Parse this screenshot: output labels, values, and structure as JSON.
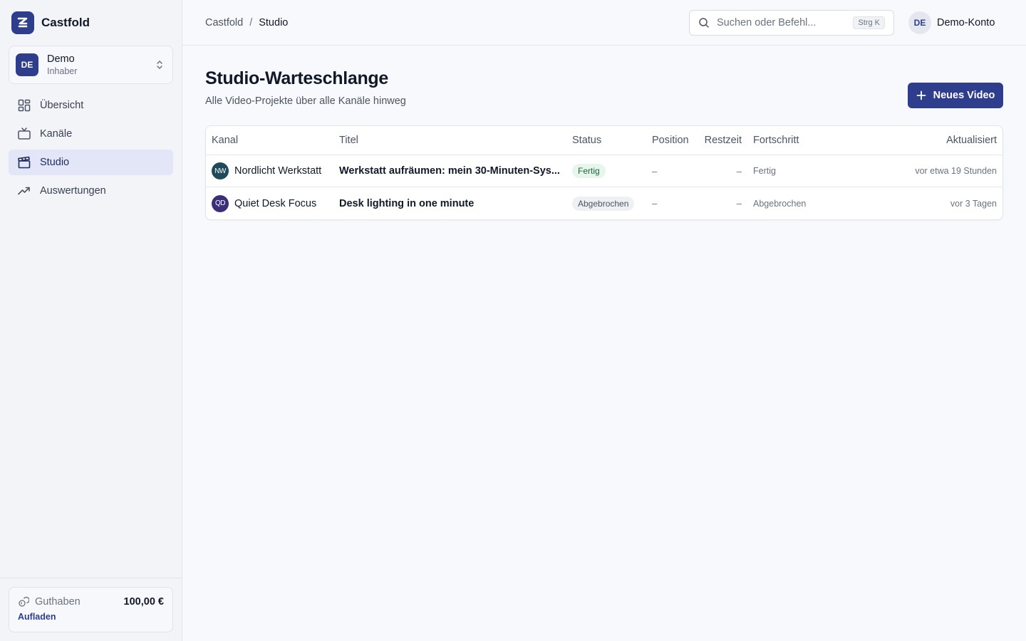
{
  "brand": {
    "name": "Castfold",
    "color": "#2f3e8c"
  },
  "workspace": {
    "initials": "DE",
    "name": "Demo",
    "role": "Inhaber"
  },
  "nav": {
    "items": [
      {
        "label": "Übersicht",
        "icon": "grid-icon",
        "active": false
      },
      {
        "label": "Kanäle",
        "icon": "tv-icon",
        "active": false
      },
      {
        "label": "Studio",
        "icon": "clapperboard-icon",
        "active": true
      },
      {
        "label": "Auswertungen",
        "icon": "trending-up-icon",
        "active": false
      }
    ]
  },
  "credit": {
    "label": "Guthaben",
    "amount": "100,00 €",
    "topup": "Aufladen"
  },
  "breadcrumb": {
    "root": "Castfold",
    "separator": "/",
    "current": "Studio"
  },
  "search": {
    "placeholder": "Suchen oder Befehl...",
    "shortcut": "Strg K"
  },
  "account": {
    "initials": "DE",
    "name": "Demo-Konto"
  },
  "page": {
    "title": "Studio-Warteschlange",
    "subtitle": "Alle Video-Projekte über alle Kanäle hinweg",
    "new_button": "Neues Video"
  },
  "table": {
    "headers": {
      "kanal": "Kanal",
      "titel": "Titel",
      "status": "Status",
      "position": "Position",
      "restzeit": "Restzeit",
      "fortschritt": "Fortschritt",
      "aktualisiert": "Aktualisiert"
    },
    "rows": [
      {
        "channel_initials": "NW",
        "channel_color": "#1f4a5a",
        "channel": "Nordlicht Werkstatt",
        "title": "Werkstatt aufräumen: mein 30-Minuten-Sys...",
        "status": "Fertig",
        "position": "–",
        "restzeit": "–",
        "progress": "Fertig",
        "updated": "vor etwa 19 Stunden"
      },
      {
        "channel_initials": "QD",
        "channel_color": "#3b2f7a",
        "channel": "Quiet Desk Focus",
        "title": "Desk lighting in one minute",
        "status": "Abgebrochen",
        "position": "–",
        "restzeit": "–",
        "progress": "Abgebrochen",
        "updated": "vor 3 Tagen"
      }
    ]
  }
}
